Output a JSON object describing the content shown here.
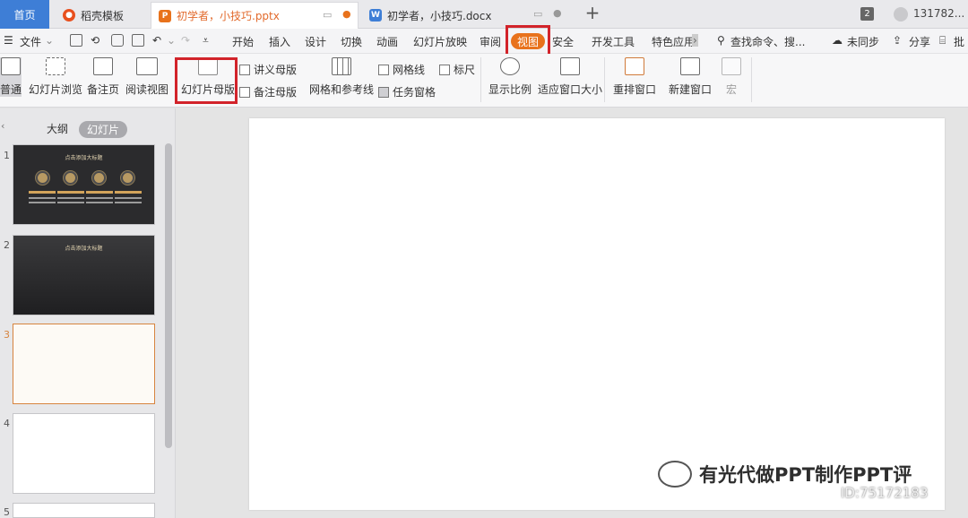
{
  "tabs": {
    "home": "首页",
    "doc1": "稻壳模板",
    "doc2": "初学者，小技巧.pptx",
    "doc3": "初学者，小技巧.docx",
    "window_count": "2",
    "user": "131782..."
  },
  "menu": {
    "file": "文件",
    "items": [
      "开始",
      "插入",
      "设计",
      "切换",
      "动画",
      "幻灯片放映",
      "审阅",
      "视图",
      "安全",
      "开发工具",
      "特色应用"
    ],
    "search": "查找命令、搜...",
    "sync": "未同步",
    "share": "分享",
    "comment": "批"
  },
  "ribbon": {
    "normal": "普通",
    "slide_sorter": "幻灯片浏览",
    "notes_page": "备注页",
    "reading_view": "阅读视图",
    "slide_master": "幻灯片母版",
    "handout_master": "讲义母版",
    "notes_master": "备注母版",
    "grid_guides": "网格和参考线",
    "gridlines": "网格线",
    "ruler": "标尺",
    "task_pane": "任务窗格",
    "zoom": "显示比例",
    "fit_window": "适应窗口大小",
    "arrange": "重排窗口",
    "new_window": "新建窗口",
    "macro": "宏"
  },
  "panel": {
    "outline": "大纲",
    "slides": "幻灯片",
    "slide_numbers": [
      "1",
      "2",
      "3",
      "4",
      "5"
    ],
    "thumb_title": "点击添加大标题"
  },
  "watermark": {
    "text": "有光代做PPT制作PPT评",
    "id": "ID:75172183"
  },
  "colors": {
    "accent": "#e8721c",
    "highlight": "#d2232a",
    "home_tab": "#3e7ed6"
  }
}
